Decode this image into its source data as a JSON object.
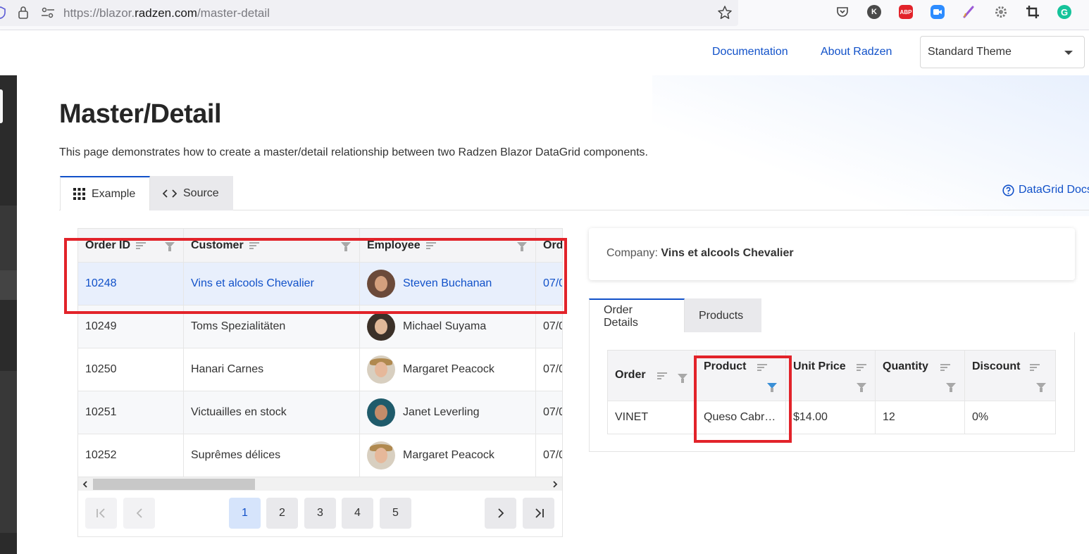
{
  "browser": {
    "url_prefix": "https://blazor.",
    "url_domain": "radzen.com",
    "url_path": "/master-detail",
    "extensions": [
      "pocket-icon",
      "k-extension-icon",
      "adblock-plus-icon",
      "zoom-icon",
      "pen-icon",
      "settings-gear-icon",
      "crop-icon",
      "grammarly-icon"
    ],
    "ext_labels": {
      "k": "K",
      "abp": "ABP",
      "g": "G"
    }
  },
  "header": {
    "documentation": "Documentation",
    "about": "About Radzen",
    "theme_value": "Standard Theme"
  },
  "page": {
    "title": "Master/Detail",
    "description": "This page demonstrates how to create a master/detail relationship between two Radzen Blazor DataGrid components.",
    "tabs": [
      {
        "label": "Example",
        "active": true
      },
      {
        "label": "Source",
        "active": false
      }
    ],
    "docs_link": "DataGrid Docs"
  },
  "master_grid": {
    "columns": [
      "Order ID",
      "Customer",
      "Employee",
      "Ord"
    ],
    "rows": [
      {
        "order_id": "10248",
        "customer": "Vins et alcools Chevalier",
        "employee": "Steven Buchanan",
        "date": "07/0",
        "selected": true
      },
      {
        "order_id": "10249",
        "customer": "Toms Spezialitäten",
        "employee": "Michael Suyama",
        "date": "07/0",
        "selected": false
      },
      {
        "order_id": "10250",
        "customer": "Hanari Carnes",
        "employee": "Margaret Peacock",
        "date": "07/0",
        "selected": false
      },
      {
        "order_id": "10251",
        "customer": "Victuailles en stock",
        "employee": "Janet Leverling",
        "date": "07/0",
        "selected": false
      },
      {
        "order_id": "10252",
        "customer": "Suprêmes délices",
        "employee": "Margaret Peacock",
        "date": "07/0",
        "selected": false
      }
    ],
    "pager": {
      "pages": [
        "1",
        "2",
        "3",
        "4",
        "5"
      ],
      "current": "1"
    }
  },
  "detail": {
    "company_label": "Company:",
    "company_name": "Vins et alcools Chevalier",
    "tabs": [
      {
        "label": "Order Details",
        "active": true
      },
      {
        "label": "Products",
        "active": false
      }
    ],
    "columns": [
      "Order",
      "Product",
      "Unit Price",
      "Quantity",
      "Discount"
    ],
    "rows": [
      {
        "order": "VINET",
        "product": "Queso Cabr…",
        "unit_price": "$14.00",
        "quantity": "12",
        "discount": "0%"
      }
    ]
  },
  "colors": {
    "accent": "#1151c9",
    "highlight_box": "#e2232a",
    "selected_row": "#e8effc",
    "active_filter": "#3a8fd6"
  }
}
